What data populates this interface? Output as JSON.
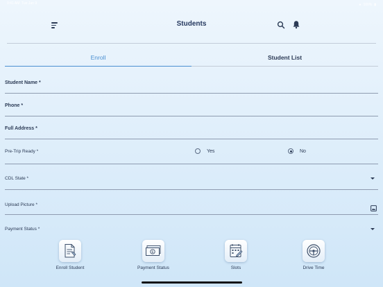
{
  "status_bar": {
    "time": "9:41 AM",
    "date": "Tue Jan 9",
    "battery": "100%"
  },
  "header": {
    "title": "Students"
  },
  "tabs": [
    {
      "label": "Enroll",
      "active": true
    },
    {
      "label": "Student List",
      "active": false
    }
  ],
  "form": {
    "student_name": {
      "label": "Student Name *",
      "value": ""
    },
    "phone": {
      "label": "Phone *",
      "value": ""
    },
    "full_address": {
      "label": "Full Address *",
      "value": ""
    },
    "pre_trip_ready": {
      "label": "Pre-Trip Ready *",
      "options": [
        {
          "label": "Yes",
          "selected": false
        },
        {
          "label": "No",
          "selected": true
        }
      ]
    },
    "cdl_state": {
      "label": "CDL State *",
      "value": ""
    },
    "upload_picture": {
      "label": "Upload Picture *"
    },
    "payment_status": {
      "label": "Payment Status *",
      "value": ""
    }
  },
  "bottom_nav": [
    {
      "label": "Enroll Student",
      "icon": "enroll-document-icon"
    },
    {
      "label": "Payment Status",
      "icon": "cash-icon"
    },
    {
      "label": "Slots",
      "icon": "calendar-edit-icon"
    },
    {
      "label": "Drive Time",
      "icon": "steering-wheel-icon"
    }
  ],
  "colors": {
    "accent": "#4a8fd1",
    "text": "#2b3a55",
    "background_top": "#eef6fd",
    "background_bottom": "#cfe6f8"
  }
}
